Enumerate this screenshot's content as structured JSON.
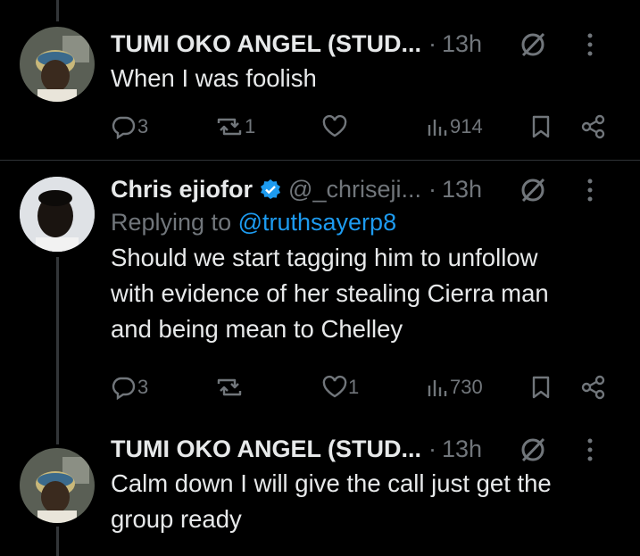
{
  "tweets": [
    {
      "name": "TUMI OKO ANGEL (STUD...",
      "handle": "",
      "time": "13h",
      "text": "When I was foolish",
      "replying_to_prefix": "",
      "replying_to_handle": "",
      "stats": {
        "replies": "3",
        "reposts": "1",
        "likes": "",
        "views": "914"
      }
    },
    {
      "name": "Chris ejiofor",
      "handle": "@_chriseji...",
      "time": "13h",
      "replying_to_prefix": "Replying to ",
      "replying_to_handle": "@truthsayerp8",
      "text_lines": [
        "Should we start tagging him to unfollow",
        "with evidence of her stealing Cierra man",
        "and being mean to Chelley"
      ],
      "stats": {
        "replies": "3",
        "reposts": "",
        "likes": "1",
        "views": "730"
      }
    },
    {
      "name": "TUMI OKO ANGEL (STUD...",
      "handle": "",
      "time": "13h",
      "text_lines": [
        "Calm down I will give the call just get the",
        "group ready"
      ]
    }
  ],
  "colors": {
    "background": "#000000",
    "text": "#e7e9ea",
    "muted": "#71767b",
    "link": "#1d9bf0",
    "verified": "#1d9bf0"
  },
  "icons": [
    "reply-icon",
    "repost-icon",
    "like-icon",
    "views-icon",
    "bookmark-icon",
    "share-icon",
    "grok-icon",
    "more-icon",
    "verified-badge-icon"
  ]
}
